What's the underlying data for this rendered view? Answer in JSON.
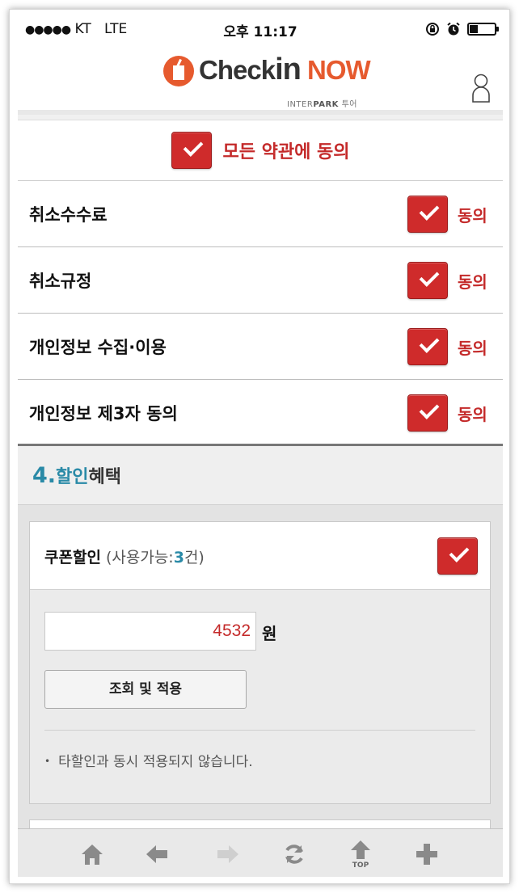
{
  "status_bar": {
    "signal_dots": "●●●●●",
    "carrier": "KT",
    "network": "LTE",
    "time": "오후 11:17"
  },
  "header": {
    "logo_check": "Check",
    "logo_in": "in",
    "logo_now": "NOW",
    "logo_sub_prefix": "INTER",
    "logo_sub_park": "PARK",
    "logo_sub_suffix": "투어"
  },
  "terms": {
    "agree_all_label": "모든 약관에 동의",
    "agree_label": "동의",
    "items": [
      {
        "label": "취소수수료"
      },
      {
        "label": "취소규정"
      },
      {
        "label": "개인정보 수집·이용"
      },
      {
        "label": "개인정보 제3자 동의"
      }
    ]
  },
  "discount_section": {
    "number": "4.",
    "title_highlight": "할인",
    "title_rest": "혜택",
    "coupon": {
      "title": "쿠폰할인",
      "sub_prefix": " (사용가능:",
      "sub_count": "3",
      "sub_suffix": "건)",
      "amount_value": "4532",
      "currency_unit": "원",
      "apply_button": "조회 및 적용",
      "note": "타할인과 동시 적용되지 않습니다."
    }
  },
  "toolbar": {
    "top_label": "TOP"
  },
  "colors": {
    "accent_red": "#cf2b2b",
    "accent_teal": "#2a8aa7",
    "brand_orange": "#e65a2e"
  }
}
